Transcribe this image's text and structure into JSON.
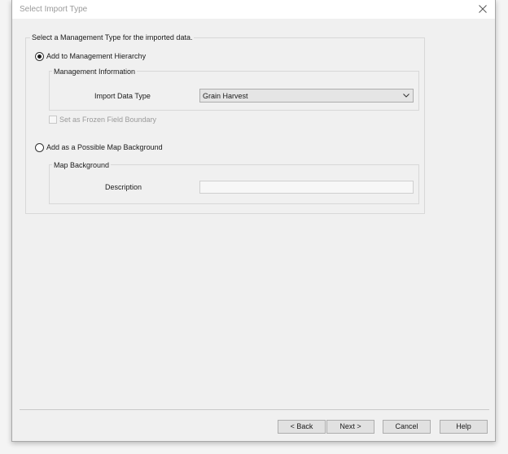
{
  "window": {
    "title": "Select Import Type"
  },
  "group": {
    "caption": "Select a Management Type for the imported data."
  },
  "hierarchy": {
    "radio_label": "Add to Management Hierarchy",
    "selected": true,
    "subgroup_caption": "Management Information",
    "import_data_type_label": "Import Data Type",
    "import_data_type_value": "Grain Harvest",
    "frozen_boundary_label": "Set as Frozen Field Boundary"
  },
  "background": {
    "radio_label": "Add as a Possible Map Background",
    "selected": false,
    "subgroup_caption": "Map Background",
    "description_label": "Description",
    "description_value": ""
  },
  "buttons": {
    "back": "< Back",
    "next": "Next >",
    "cancel": "Cancel",
    "help": "Help"
  },
  "icons": {
    "close": "close-icon",
    "dropdown": "chevron-down-icon"
  },
  "colors": {
    "disabled_text": "#9a9a9a",
    "dialog_bg": "#f0f0f0"
  }
}
